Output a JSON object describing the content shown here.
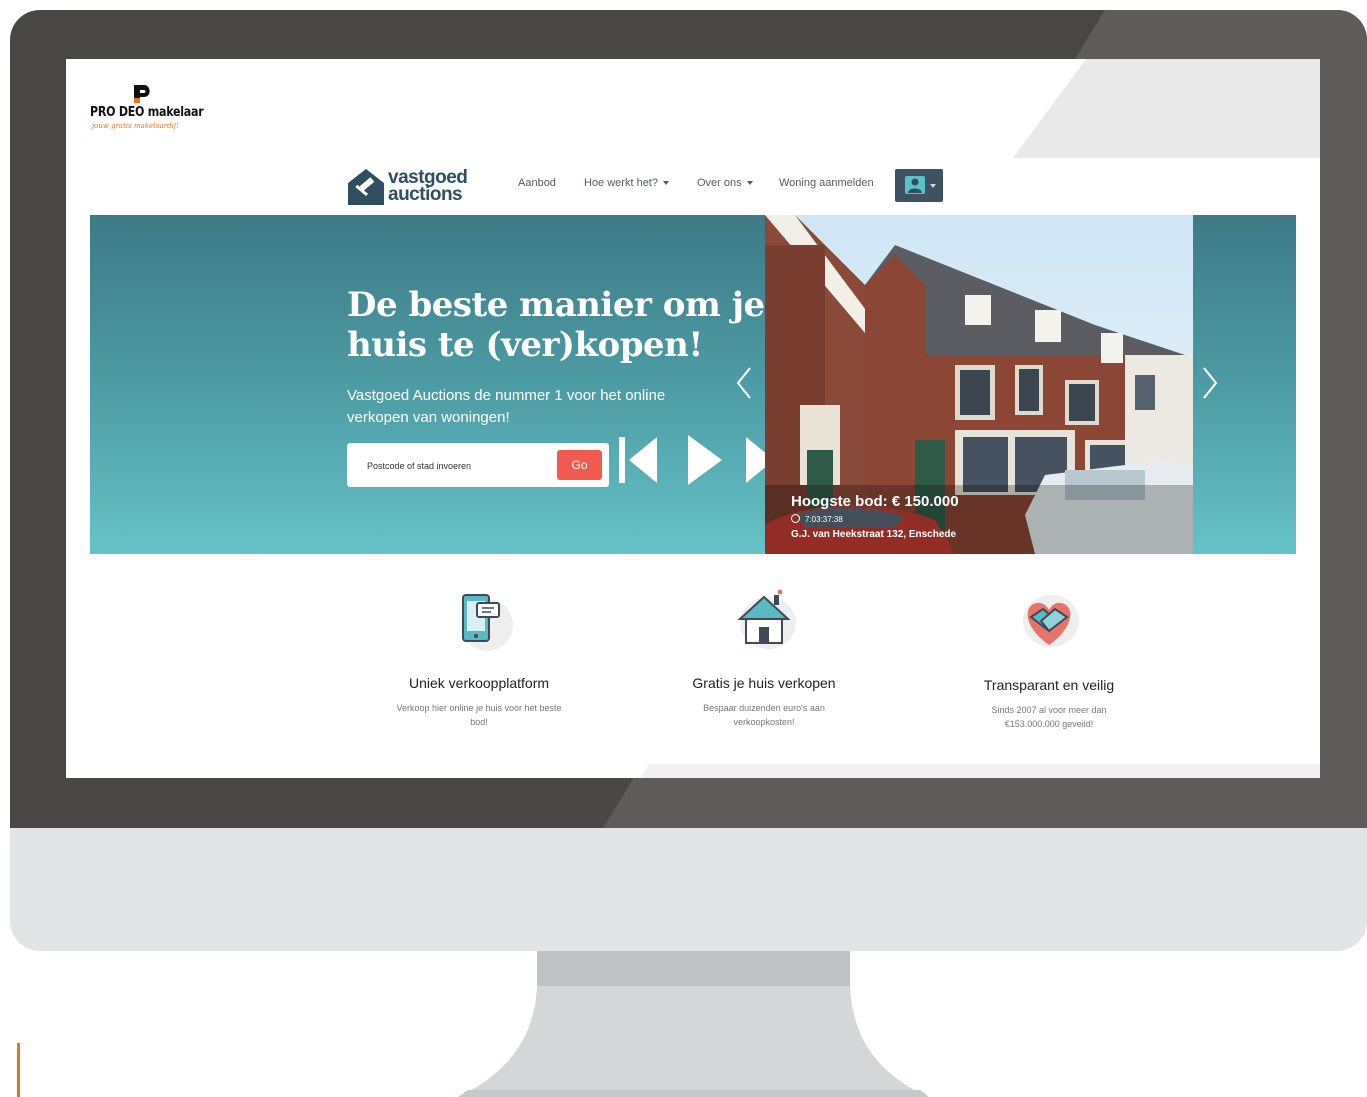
{
  "prodeo": {
    "name": "PRO DEO makelaar",
    "tagline": "jouw gratis makelaardij!"
  },
  "site_logo": {
    "line1": "vastgoed",
    "line2": "auctions"
  },
  "nav": {
    "items": [
      {
        "label": "Aanbod",
        "dropdown": false
      },
      {
        "label": "Hoe werkt het?",
        "dropdown": true
      },
      {
        "label": "Over ons",
        "dropdown": true
      },
      {
        "label": "Woning aanmelden",
        "dropdown": false
      }
    ],
    "user_icon": "user-icon"
  },
  "hero": {
    "title": "De beste manier om je huis te (ver)kopen!",
    "subtitle": "Vastgoed Auctions de nummer 1 voor het online verkopen van woningen!",
    "search_placeholder": "Postcode of stad invoeren",
    "go_label": "Go",
    "go_color": "#ef5b50"
  },
  "listing": {
    "price": "Hoogste bod: € 150.000",
    "timer": "7:03:37:38",
    "address": "G.J. van Heekstraat 132, Enschede"
  },
  "features": [
    {
      "icon": "phone-chat-icon",
      "title": "Uniek verkoopplatform",
      "text": "Verkoop hier online je huis voor het beste bod!"
    },
    {
      "icon": "house-icon",
      "title": "Gratis je huis verkopen",
      "text": "Bespaar duizenden euro's aan verkoopkosten!"
    },
    {
      "icon": "handshake-heart-icon",
      "title": "Transparant en veilig",
      "text": "Sinds 2007 al voor meer dan €153.000.000 geveild!"
    }
  ],
  "colors": {
    "frame": "#484745",
    "chin": "#e3e4e6",
    "hero_top": "#3d7a86",
    "hero_bottom": "#66c2c6",
    "brand_navy": "#2f4f61",
    "accent_orange": "#e8731f"
  }
}
